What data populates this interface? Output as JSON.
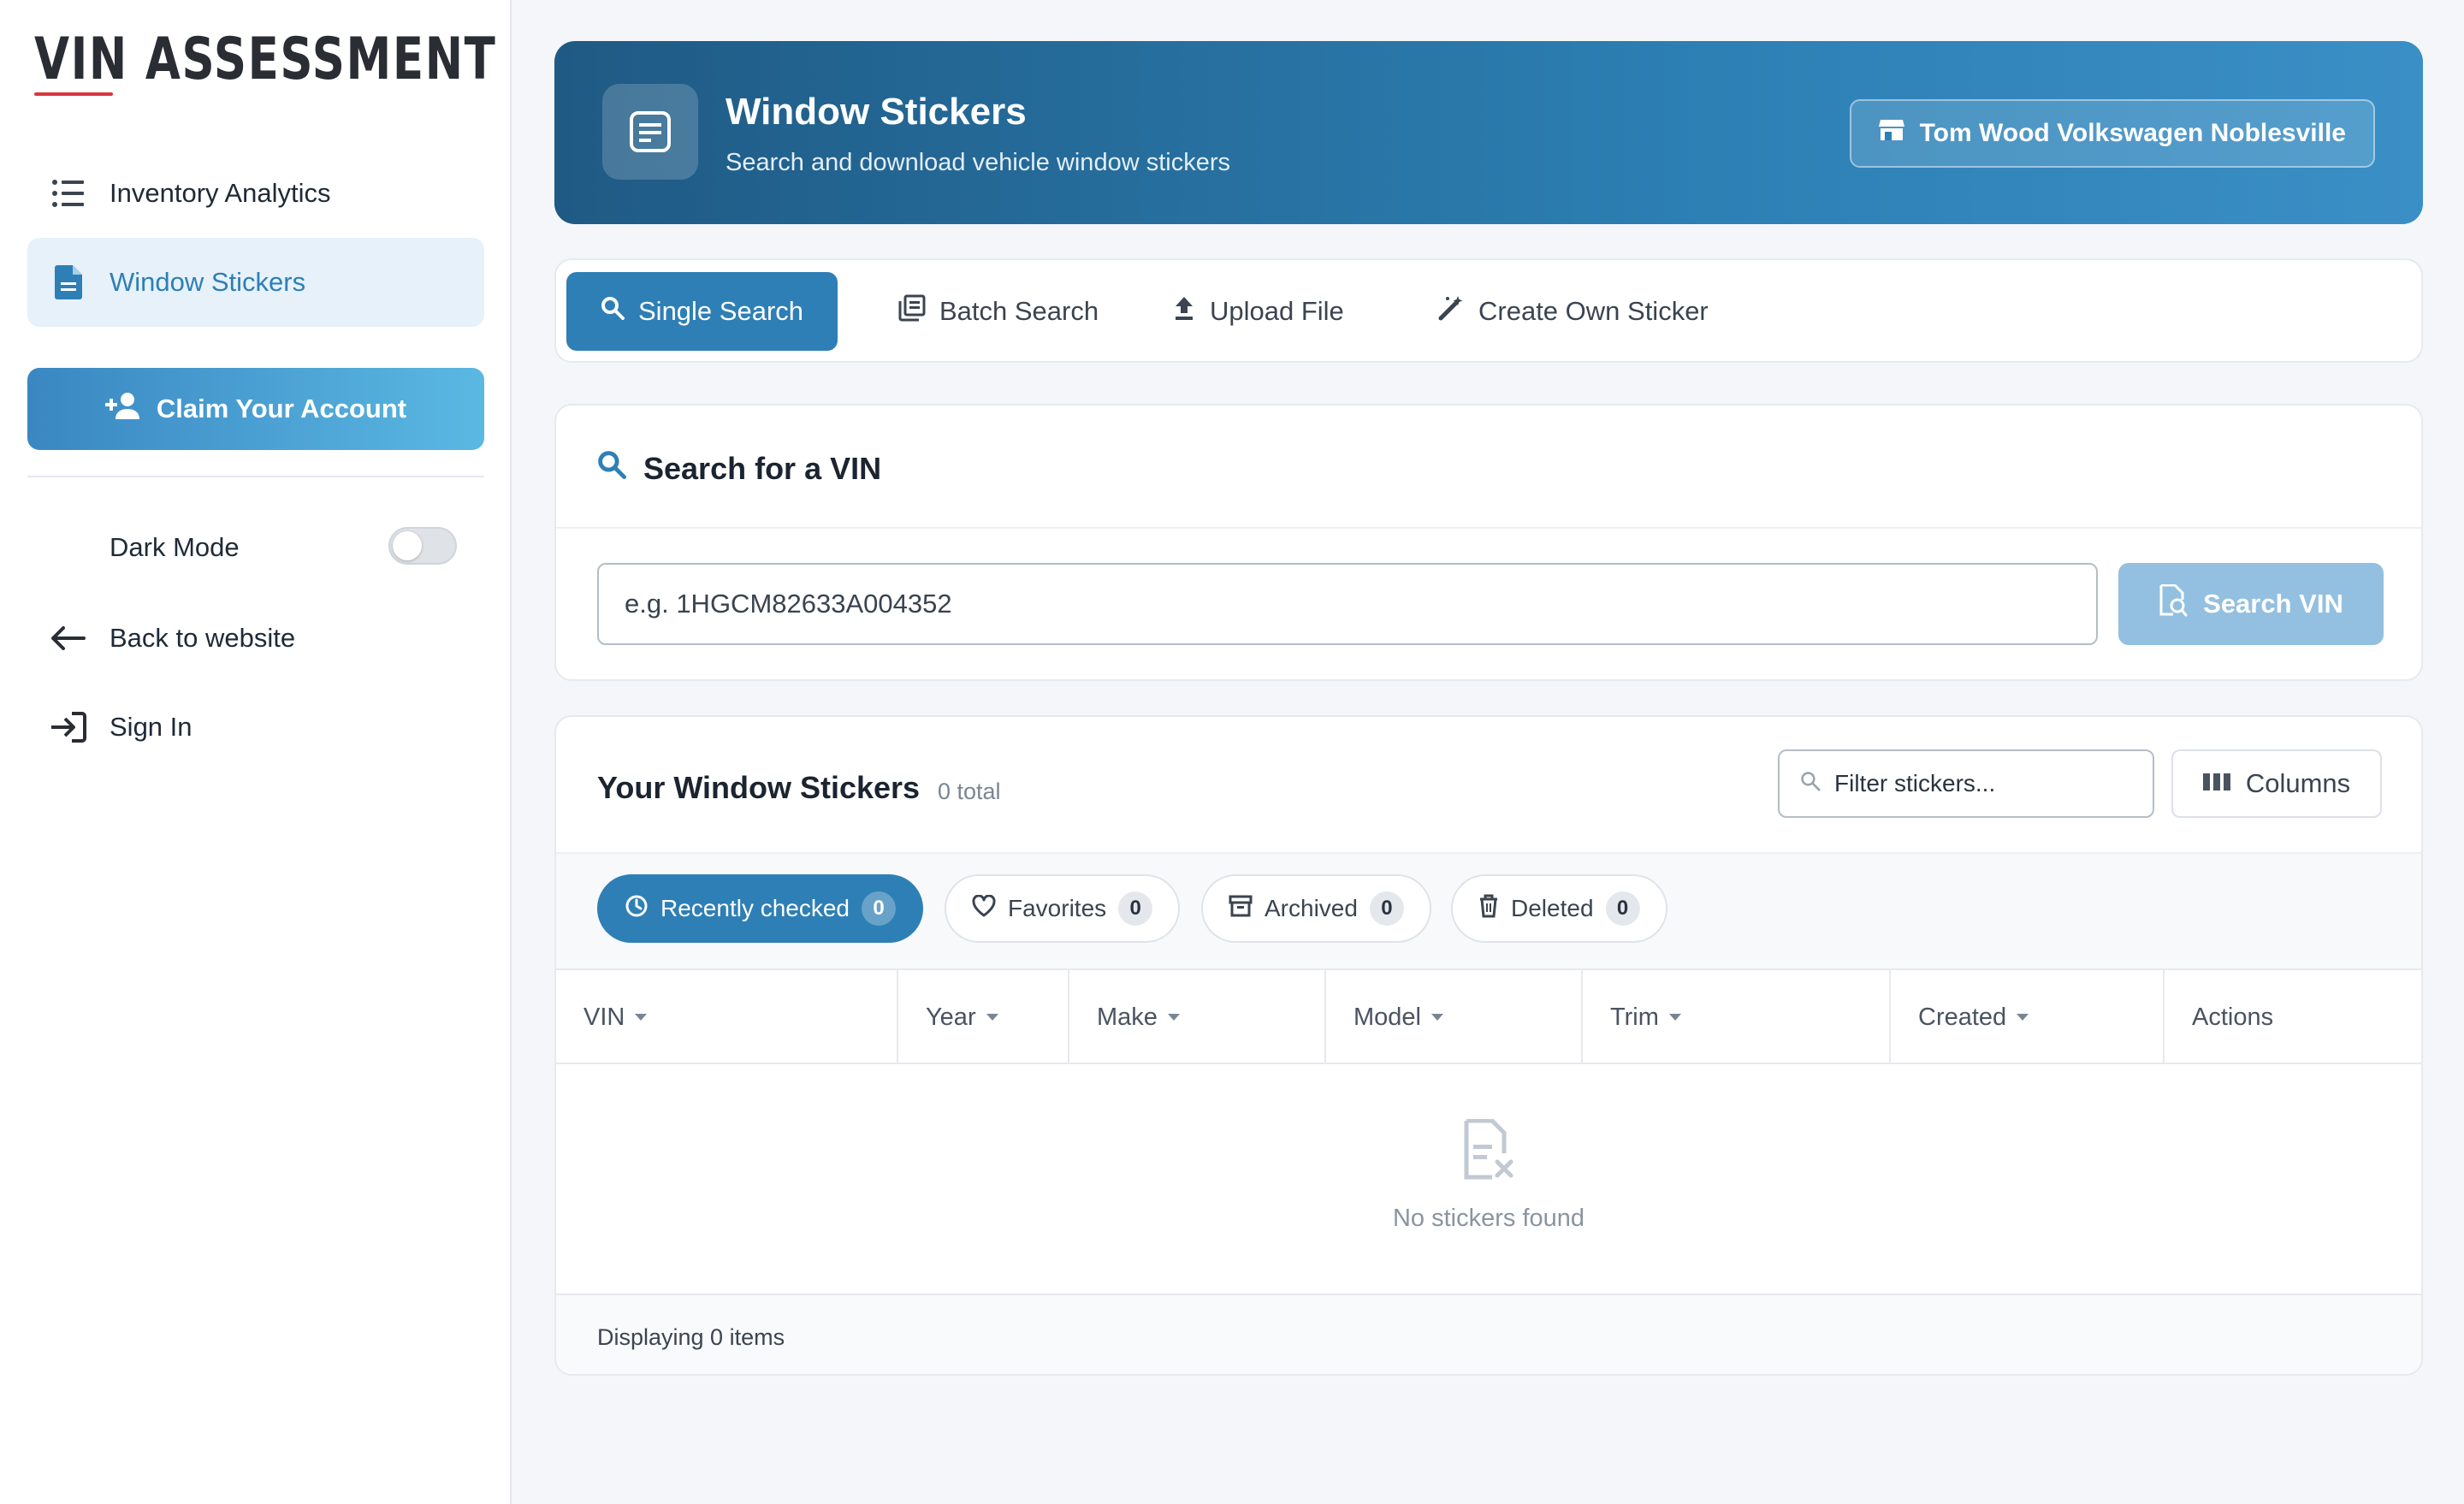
{
  "brand": {
    "title": "VIN ASSESSMENT",
    "accent": "#d9363e"
  },
  "sidebar": {
    "nav": [
      {
        "label": "Inventory Analytics",
        "icon": "list-icon"
      },
      {
        "label": "Window Stickers",
        "icon": "document-icon",
        "active": true
      }
    ],
    "claim_label": "Claim Your Account",
    "dark_mode_label": "Dark Mode",
    "dark_mode_on": false,
    "back_label": "Back to website",
    "sign_in_label": "Sign In"
  },
  "header": {
    "title": "Window Stickers",
    "subtitle": "Search and download vehicle window stickers",
    "dealer": "Tom Wood Volkswagen Noblesville"
  },
  "tabs": [
    {
      "label": "Single Search",
      "icon": "search-icon",
      "active": true
    },
    {
      "label": "Batch Search",
      "icon": "batch-icon"
    },
    {
      "label": "Upload File",
      "icon": "upload-icon"
    },
    {
      "label": "Create Own Sticker",
      "icon": "magic-wand-icon"
    }
  ],
  "search": {
    "title": "Search for a VIN",
    "placeholder": "e.g. 1HGCM82633A004352",
    "button": "Search VIN"
  },
  "stickers": {
    "title": "Your Window Stickers",
    "total": "0 total",
    "filter_placeholder": "Filter stickers...",
    "columns_label": "Columns",
    "chips": [
      {
        "label": "Recently checked",
        "count": "0",
        "icon": "clock-icon",
        "active": true
      },
      {
        "label": "Favorites",
        "count": "0",
        "icon": "heart-icon"
      },
      {
        "label": "Archived",
        "count": "0",
        "icon": "archive-icon"
      },
      {
        "label": "Deleted",
        "count": "0",
        "icon": "trash-icon"
      }
    ],
    "columns": [
      "VIN",
      "Year",
      "Make",
      "Model",
      "Trim",
      "Created",
      "Actions"
    ],
    "rows": [],
    "empty_text": "No stickers found",
    "footer": "Displaying 0 items"
  },
  "colors": {
    "primary": "#2e7fb5",
    "header_start": "#1f5a84",
    "header_end": "#3a8fc6"
  }
}
